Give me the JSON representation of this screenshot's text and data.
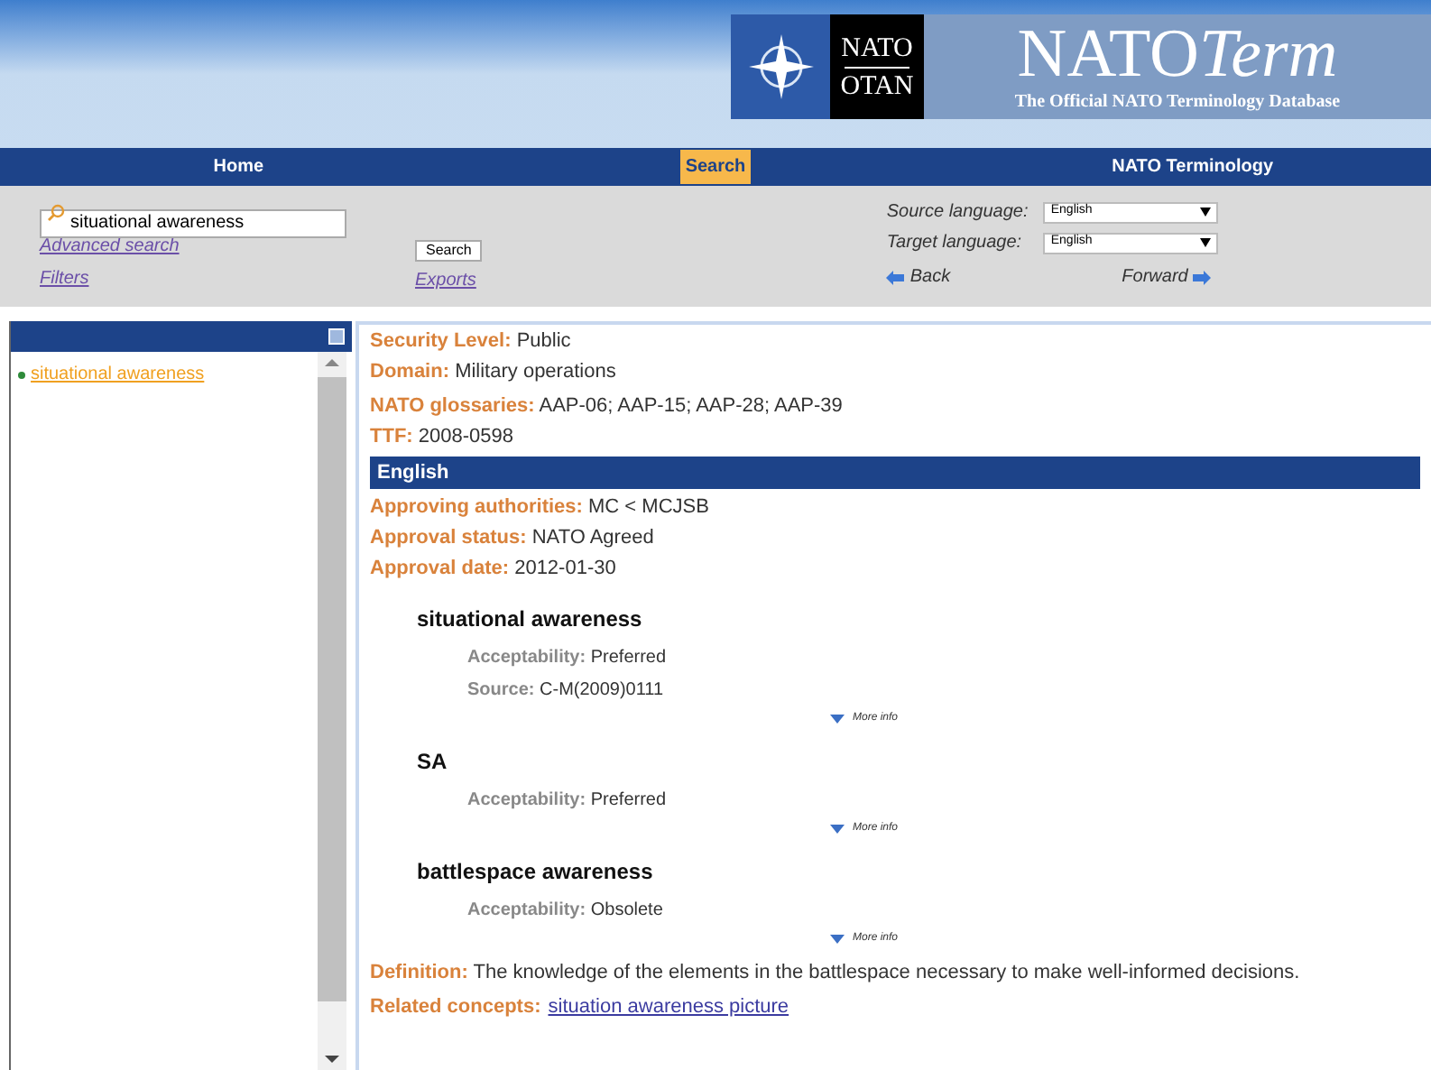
{
  "logo": {
    "emblem_top": "NATO",
    "emblem_bottom": "OTAN",
    "name_main": "NATO",
    "name_italic": "Term",
    "tagline": "The Official NATO Terminology Database"
  },
  "nav": [
    {
      "label": "Home",
      "selected": false
    },
    {
      "label": "Search",
      "selected": true
    },
    {
      "label": "NATO Terminology",
      "selected": false
    }
  ],
  "search": {
    "value": "situational awareness",
    "button": "Search",
    "links": [
      "Advanced search",
      "Filters"
    ],
    "exports": "Exports"
  },
  "languages": [
    {
      "label": "Source language:",
      "value": "English"
    },
    {
      "label": "Target language:",
      "value": "English"
    }
  ],
  "history": {
    "back": "Back",
    "forward": "Forward"
  },
  "results": [
    {
      "label": "situational awareness",
      "selected": true
    }
  ],
  "record": {
    "fields": [
      {
        "label": "Security Level:",
        "value": "Public"
      },
      {
        "label": "Domain:",
        "value": "Military operations"
      },
      {
        "label": "NATO glossaries:",
        "value": "AAP-06; AAP-15; AAP-28; AAP-39"
      },
      {
        "label": "TTF:",
        "value": "2008-0598"
      }
    ],
    "section": "English",
    "approval": [
      {
        "label": "Approving authorities:",
        "value": "MC < MCJSB"
      },
      {
        "label": "Approval status:",
        "value": "NATO Agreed"
      },
      {
        "label": "Approval date:",
        "value": "2012-01-30"
      }
    ],
    "terms": [
      {
        "term": "situational awareness",
        "details": [
          {
            "label": "Acceptability:",
            "value": "Preferred"
          },
          {
            "label": "Source:",
            "value": "C-M(2009)0111"
          }
        ],
        "more": "More info"
      },
      {
        "term": "SA",
        "details": [
          {
            "label": "Acceptability:",
            "value": "Preferred"
          }
        ],
        "more": "More info"
      },
      {
        "term": "battlespace awareness",
        "details": [
          {
            "label": "Acceptability:",
            "value": "Obsolete"
          }
        ],
        "more": "More info"
      }
    ],
    "definition": {
      "label": "Definition:",
      "value": "The knowledge of the elements in the battlespace necessary to make well-informed decisions."
    },
    "related": {
      "label": "Related concepts:",
      "link": "situation awareness picture"
    }
  }
}
